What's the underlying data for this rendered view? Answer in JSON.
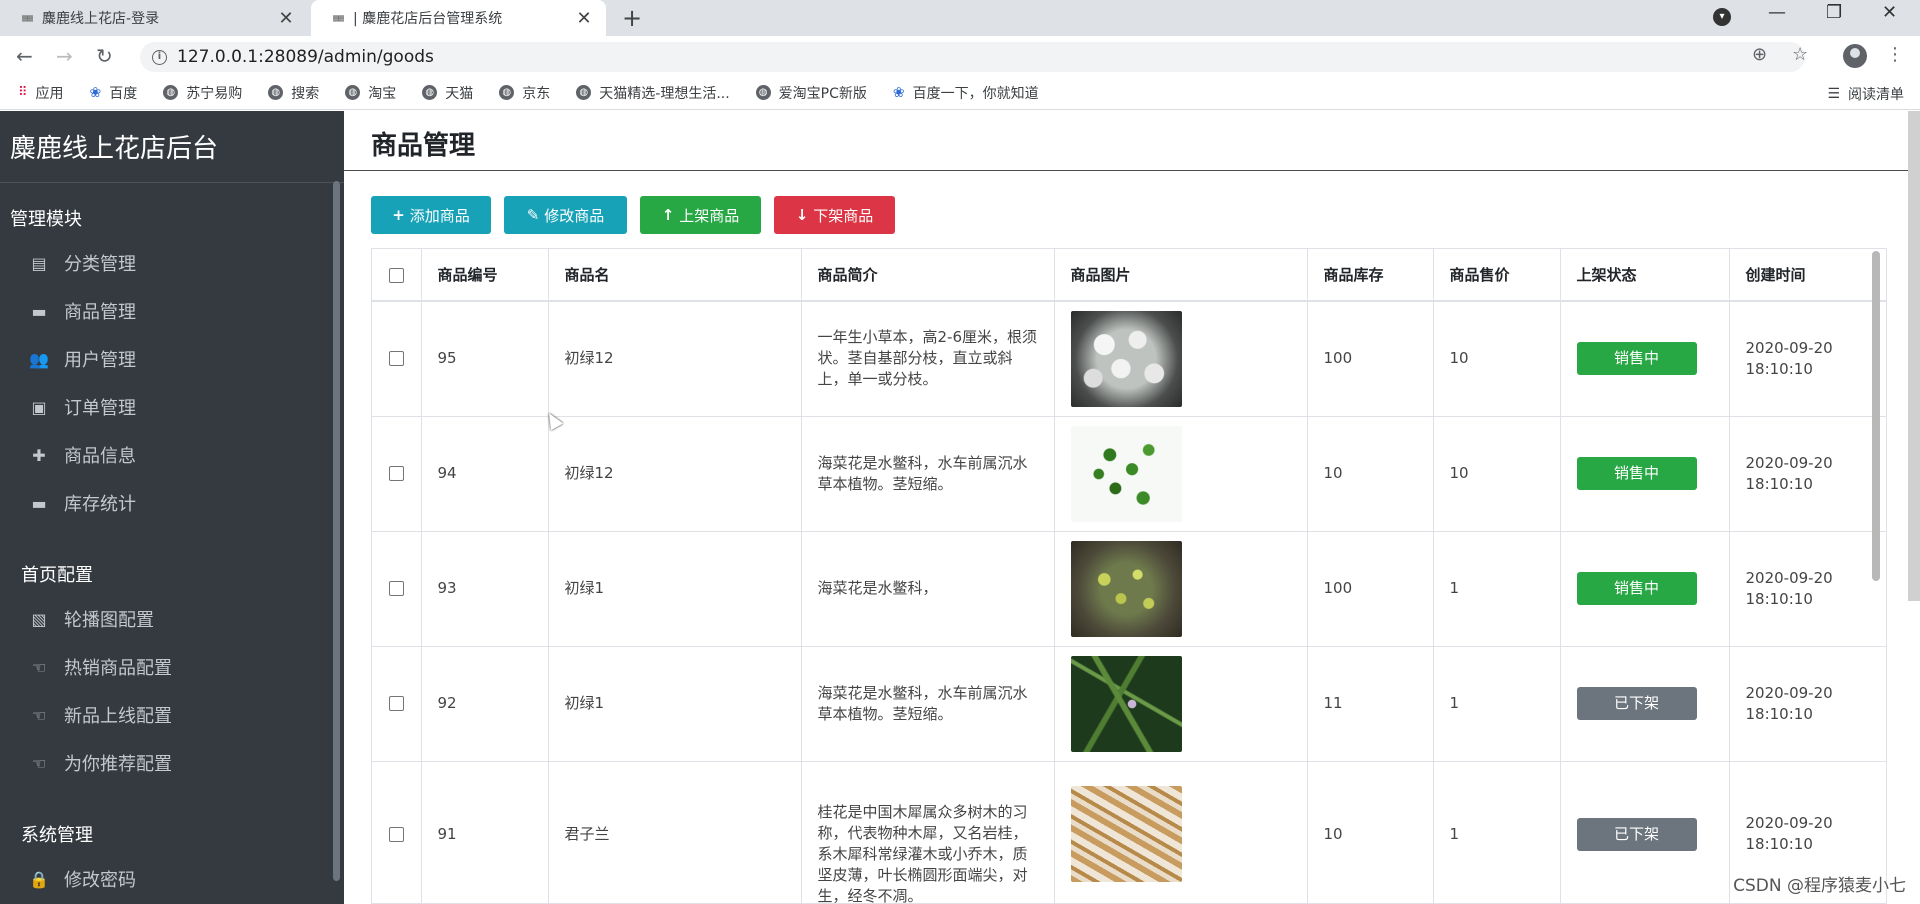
{
  "browser": {
    "tabs": [
      {
        "title": "麋鹿线上花店-登录",
        "active": false
      },
      {
        "title": "麋鹿花店后台管理系统",
        "active": true
      }
    ],
    "address": "127.0.0.1:28089/admin/goods",
    "bookmarks": [
      {
        "label": "应用",
        "icon": "apps-grid-icon"
      },
      {
        "label": "百度",
        "icon": "baidu-paw-icon"
      },
      {
        "label": "苏宁易购",
        "icon": "globe-icon"
      },
      {
        "label": "搜索",
        "icon": "globe-icon"
      },
      {
        "label": "淘宝",
        "icon": "globe-icon"
      },
      {
        "label": "天猫",
        "icon": "globe-icon"
      },
      {
        "label": "京东",
        "icon": "globe-icon"
      },
      {
        "label": "天猫精选-理想生活...",
        "icon": "globe-icon"
      },
      {
        "label": "爱淘宝PC新版",
        "icon": "globe-icon"
      },
      {
        "label": "百度一下，你就知道",
        "icon": "baidu-paw-icon"
      }
    ],
    "reading_list": "阅读清单"
  },
  "sidebar": {
    "brand": "麋鹿线上花店后台",
    "groups": [
      {
        "title": "管理模块",
        "items": [
          {
            "label": "分类管理",
            "icon": "list-icon"
          },
          {
            "label": "商品管理",
            "icon": "archive-icon"
          },
          {
            "label": "用户管理",
            "icon": "users-icon"
          },
          {
            "label": "订单管理",
            "icon": "money-icon"
          },
          {
            "label": "商品信息",
            "icon": "plus-icon"
          },
          {
            "label": "库存统计",
            "icon": "archive-icon"
          }
        ]
      },
      {
        "title": "首页配置",
        "items": [
          {
            "label": "轮播图配置",
            "icon": "image-icon"
          },
          {
            "label": "热销商品配置",
            "icon": "hand-pointer-icon"
          },
          {
            "label": "新品上线配置",
            "icon": "hand-pointer-icon"
          },
          {
            "label": "为你推荐配置",
            "icon": "hand-pointer-icon"
          }
        ]
      },
      {
        "title": "系统管理",
        "items": [
          {
            "label": "修改密码",
            "icon": "lock-icon"
          }
        ]
      }
    ]
  },
  "main": {
    "title": "商品管理",
    "toolbar": {
      "add": "添加商品",
      "edit": "修改商品",
      "list_up": "上架商品",
      "list_down": "下架商品"
    },
    "columns": [
      "商品编号",
      "商品名",
      "商品简介",
      "商品图片",
      "商品库存",
      "商品售价",
      "上架状态",
      "创建时间"
    ],
    "rows": [
      {
        "id": "95",
        "name": "初绿12",
        "intro": "一年生小草本，高2-6厘米，根须状。茎自基部分枝，直立或斜上，单一或分枝。",
        "image": "white-cactus",
        "stock": "100",
        "price": "10",
        "status": "销售中",
        "on": true,
        "created_date": "2020-09-20",
        "created_time": "18:10:10"
      },
      {
        "id": "94",
        "name": "初绿12",
        "intro": "海菜花是水鳖科，水车前属沉水草本植物。茎短缩。",
        "image": "hanging-plant",
        "stock": "10",
        "price": "10",
        "status": "销售中",
        "on": true,
        "created_date": "2020-09-20",
        "created_time": "18:10:10"
      },
      {
        "id": "93",
        "name": "初绿1",
        "intro": "海菜花是水鳖科，",
        "image": "round-cactus",
        "stock": "100",
        "price": "1",
        "status": "销售中",
        "on": true,
        "created_date": "2020-09-20",
        "created_time": "18:10:10"
      },
      {
        "id": "92",
        "name": "初绿1",
        "intro": "海菜花是水鳖科，水车前属沉水草本植物。茎短缩。",
        "image": "grass-flower",
        "stock": "11",
        "price": "1",
        "status": "已下架",
        "on": false,
        "created_date": "2020-09-20",
        "created_time": "18:10:10"
      },
      {
        "id": "91",
        "name": "君子兰",
        "intro": "桂花是中国木犀属众多树木的习称，代表物种木犀，又名岩桂，系木犀科常绿灌木或小乔木，质坚皮薄，叶长椭圆形面端尖，对生，经冬不凋。",
        "image": "dried-roots",
        "stock": "10",
        "price": "1",
        "status": "已下架",
        "on": false,
        "created_date": "2020-09-20",
        "created_time": "18:10:10"
      }
    ]
  },
  "watermark": "CSDN @程序猿麦小七",
  "colors": {
    "sidebar_bg": "#343a40",
    "info": "#17a2b8",
    "success": "#28a745",
    "danger": "#dc3545",
    "secondary": "#6c757d"
  }
}
